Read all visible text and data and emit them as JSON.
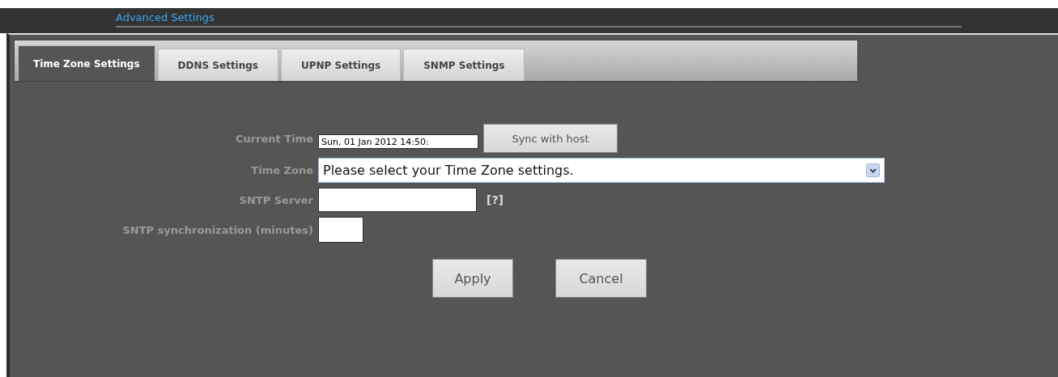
{
  "header": {
    "title": "Advanced Settings"
  },
  "tabs": [
    {
      "label": "Time Zone Settings",
      "selected": true
    },
    {
      "label": "DDNS Settings",
      "selected": false
    },
    {
      "label": "UPNP Settings",
      "selected": false
    },
    {
      "label": "SNMP Settings",
      "selected": false
    }
  ],
  "form": {
    "current_time": {
      "label": "Current Time",
      "value": "Sun, 01 Jan 2012 14:50:",
      "button": "Sync with host"
    },
    "time_zone": {
      "label": "Time Zone",
      "value": "Please select your Time Zone settings."
    },
    "sntp_server": {
      "label": "SNTP Server",
      "help": "[?]"
    },
    "sntp_sync": {
      "label": "SNTP synchronization (minutes)"
    }
  },
  "buttons": [
    "Apply",
    "Cancel"
  ]
}
